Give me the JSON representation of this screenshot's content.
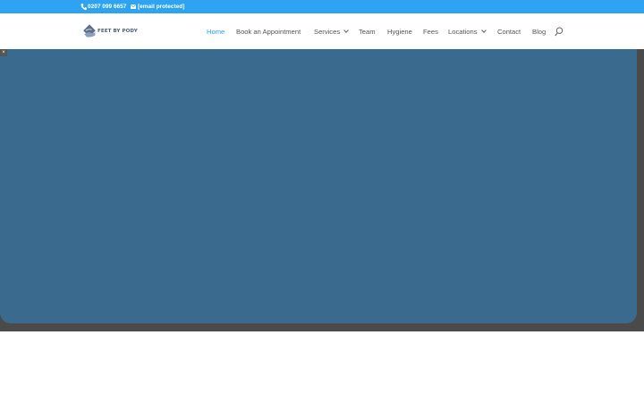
{
  "topbar": {
    "phone": "0207 099 6657",
    "email": "[email protected]",
    "phone_icon": "phone-icon",
    "email_icon": "envelope-icon",
    "background": "#2ea3f2"
  },
  "header": {
    "logo_text": "FEET BY PODY",
    "nav": [
      {
        "label": "Home",
        "active": true
      },
      {
        "label": "Book an Appointment"
      },
      {
        "label": "Services",
        "has_dropdown": true
      },
      {
        "label": "Team"
      },
      {
        "label": "Hygiene"
      },
      {
        "label": "Fees"
      },
      {
        "label": "Locations",
        "has_dropdown": true
      },
      {
        "label": "Contact"
      },
      {
        "label": "Blog"
      }
    ],
    "search_icon": "search-icon",
    "active_color": "#2ea3f2"
  },
  "hero": {
    "panel_color": "#3b6a8f",
    "backdrop_color": "#4a4a4a",
    "corner_control": "×"
  }
}
